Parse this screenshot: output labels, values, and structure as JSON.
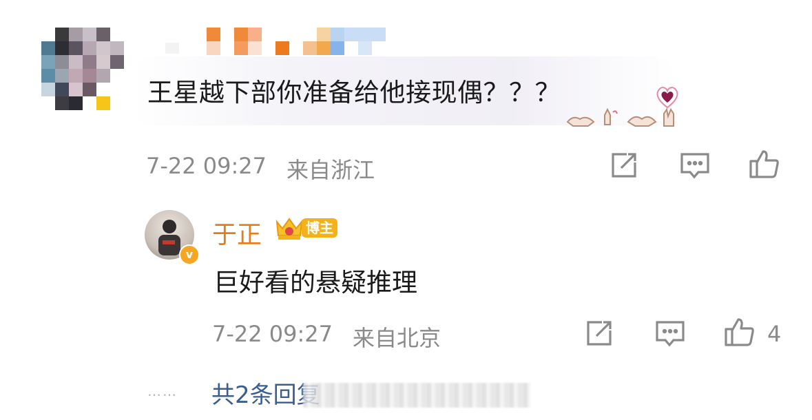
{
  "comment": {
    "text": "王星越下部你准备给他接现偶？？？",
    "timestamp": "7-22 09:27",
    "location": "来自浙江",
    "share_icon": "share-icon",
    "reply_icon": "comment-icon",
    "like_icon": "thumbs-up-icon"
  },
  "reply": {
    "author": "于正",
    "badge": "博主",
    "text": "巨好看的悬疑推理",
    "timestamp": "7-22 09:27",
    "location": "来自北京",
    "like_count": "4"
  },
  "footer": {
    "dots": "……",
    "more_replies": "共2条回复"
  },
  "colors": {
    "author_name": "#e57c18",
    "badge": "#f3b21a",
    "link": "#3a5f8f",
    "meta": "#8a8a8a"
  }
}
